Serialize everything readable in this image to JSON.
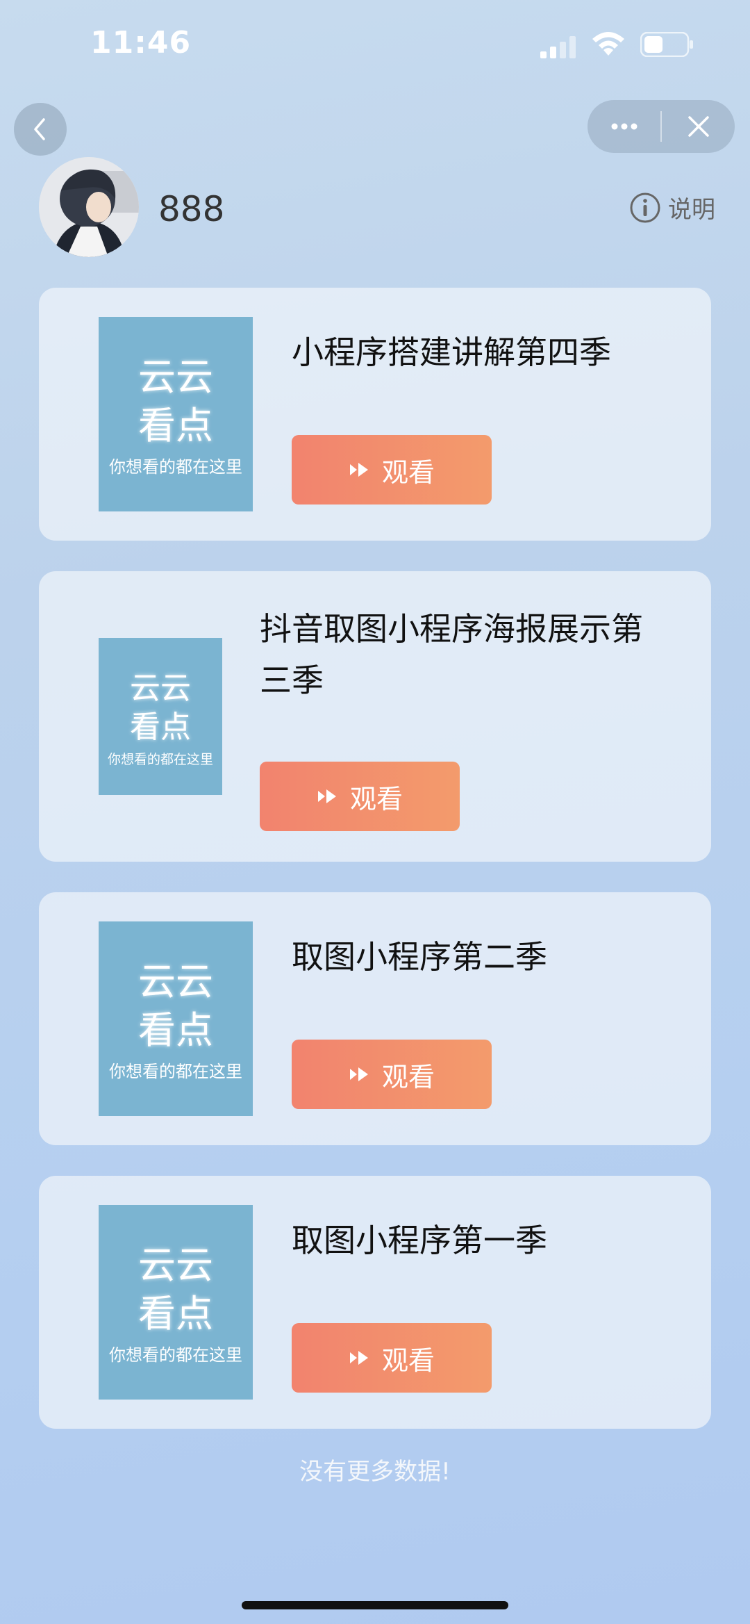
{
  "status_bar": {
    "time": "11:46"
  },
  "nav": {
    "more_icon": "more-icon",
    "close_icon": "close-icon",
    "back_icon": "back-icon"
  },
  "user": {
    "name": "888",
    "help_label": "说明"
  },
  "thumbnail": {
    "line1": "云云",
    "line2": "看点",
    "line3": "你想看的都在这里"
  },
  "items": [
    {
      "title": "小程序搭建讲解第四季",
      "button": "观看"
    },
    {
      "title": "抖音取图小程序海报展示第三季",
      "button": "观看"
    },
    {
      "title": "取图小程序第二季",
      "button": "观看"
    },
    {
      "title": "取图小程序第一季",
      "button": "观看"
    }
  ],
  "footer": "没有更多数据!",
  "colors": {
    "button_start": "#f2836e",
    "button_end": "#f39b6c",
    "thumb_bg": "#7bb4d1"
  }
}
